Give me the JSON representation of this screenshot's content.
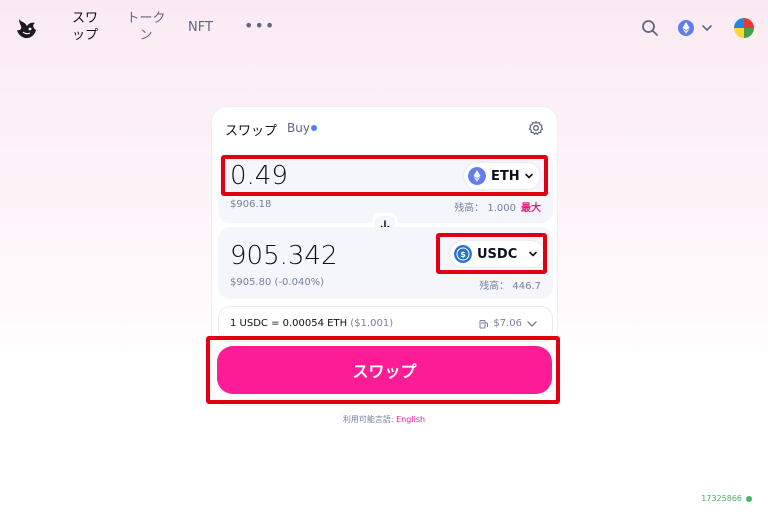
{
  "nav": {
    "items": [
      {
        "label": "スワップ"
      },
      {
        "label": "トークン"
      },
      {
        "label": "NFT"
      }
    ],
    "more_label": "•••"
  },
  "swap": {
    "tabs": {
      "swap": "スワップ",
      "buy": "Buy"
    },
    "input": {
      "amount": "0.49",
      "token": "ETH",
      "usd_value": "$906.18",
      "balance": "残高： 1.000",
      "max_label": "最大"
    },
    "output": {
      "amount": "905.342",
      "token": "USDC",
      "usd_value": "$905.80",
      "usd_delta": "(-0.040%)",
      "balance": "残高： 446.7"
    },
    "rate": {
      "text": "1 USDC = 0.00054 ETH",
      "usd": "($1.001)",
      "gas": "$7.06"
    },
    "button_label": "スワップ"
  },
  "footer": {
    "lang_prefix": "利用可能言語:",
    "lang_link": "English",
    "block_number": "17325866"
  },
  "colors": {
    "accent": "#fc1c96",
    "highlight": "#e00012",
    "eth": "#627eea",
    "usdc": "#2775ca",
    "block": "#40b66b"
  }
}
